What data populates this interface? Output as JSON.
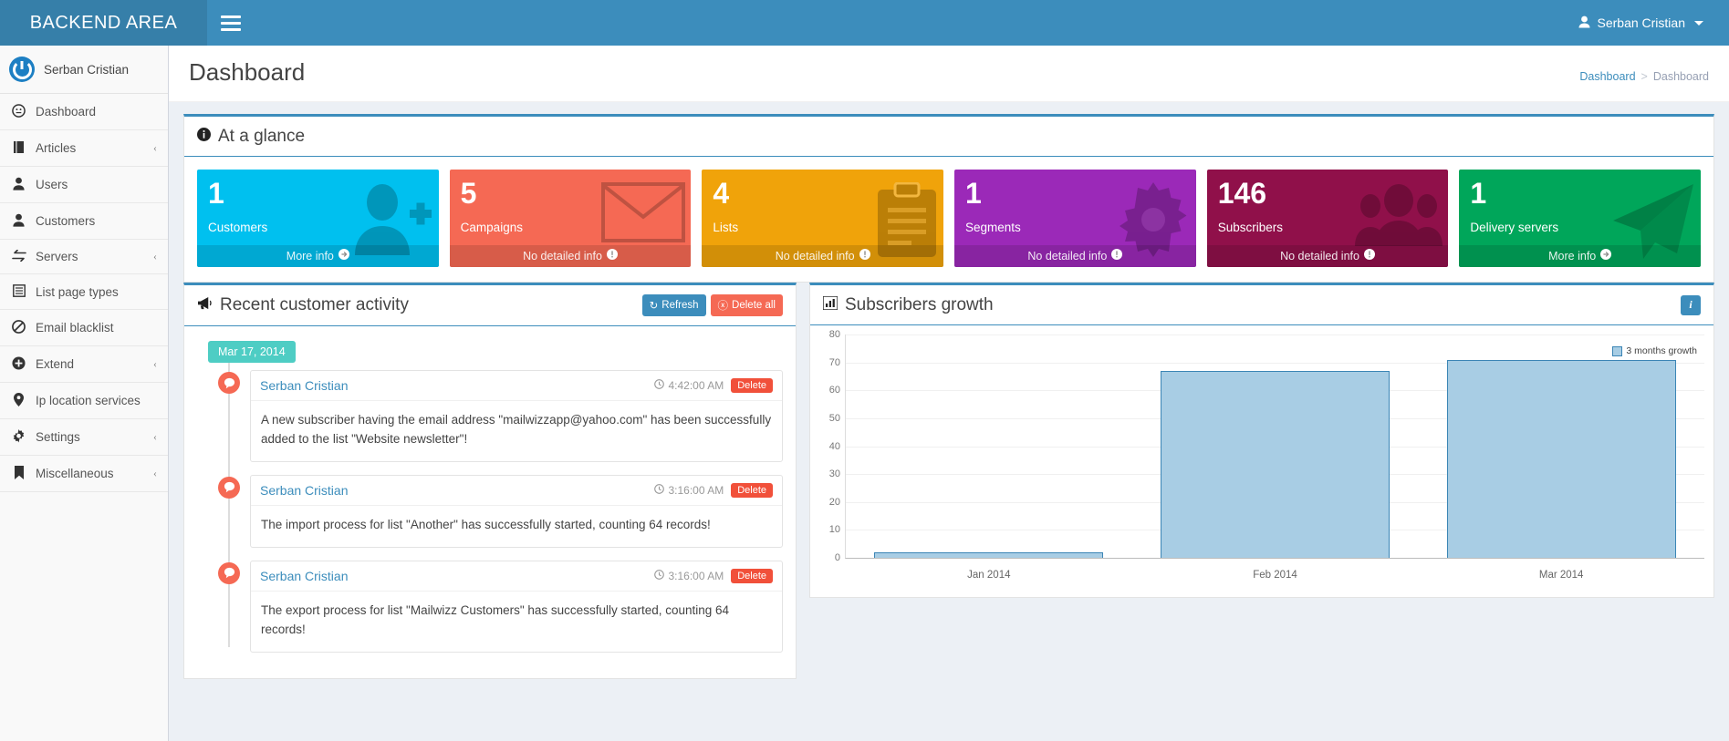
{
  "topbar": {
    "brand": "BACKEND AREA",
    "menu_toggle_icon": "hamburger-icon",
    "user_name": "Serban Cristian",
    "user_icon": "user-icon"
  },
  "sidebar": {
    "user_name": "Serban Cristian",
    "items": [
      {
        "label": "Dashboard",
        "icon": "dashboard-icon",
        "chevron": ""
      },
      {
        "label": "Articles",
        "icon": "book-icon",
        "chevron": "‹"
      },
      {
        "label": "Users",
        "icon": "user-icon",
        "chevron": ""
      },
      {
        "label": "Customers",
        "icon": "user-icon",
        "chevron": ""
      },
      {
        "label": "Servers",
        "icon": "exchange-icon",
        "chevron": "‹"
      },
      {
        "label": "List page types",
        "icon": "list-alt-icon",
        "chevron": ""
      },
      {
        "label": "Email blacklist",
        "icon": "ban-icon",
        "chevron": ""
      },
      {
        "label": "Extend",
        "icon": "plus-circle-icon",
        "chevron": "‹"
      },
      {
        "label": "Ip location services",
        "icon": "map-marker-icon",
        "chevron": ""
      },
      {
        "label": "Settings",
        "icon": "gear-icon",
        "chevron": "‹"
      },
      {
        "label": "Miscellaneous",
        "icon": "bookmark-icon",
        "chevron": "‹"
      }
    ]
  },
  "page": {
    "title": "Dashboard",
    "breadcrumb": {
      "root": "Dashboard",
      "separator": ">",
      "current": "Dashboard"
    }
  },
  "glance": {
    "title": "At a glance",
    "icon": "info-circle-icon",
    "cards": [
      {
        "number": "1",
        "label": "Customers",
        "footer": "More info",
        "footer_icon": "arrow-circle-right-icon",
        "bg_icon": "user-plus-icon",
        "color": "#00c0ef"
      },
      {
        "number": "5",
        "label": "Campaigns",
        "footer": "No detailed info",
        "footer_icon": "exclamation-circle-icon",
        "bg_icon": "envelope-icon",
        "color": "#f56954"
      },
      {
        "number": "4",
        "label": "Lists",
        "footer": "No detailed info",
        "footer_icon": "exclamation-circle-icon",
        "bg_icon": "clipboard-icon",
        "color": "#f0a30a"
      },
      {
        "number": "1",
        "label": "Segments",
        "footer": "No detailed info",
        "footer_icon": "exclamation-circle-icon",
        "bg_icon": "gear-icon",
        "color": "#9b29b8"
      },
      {
        "number": "146",
        "label": "Subscribers",
        "footer": "No detailed info",
        "footer_icon": "exclamation-circle-icon",
        "bg_icon": "group-icon",
        "color": "#90104a"
      },
      {
        "number": "1",
        "label": "Delivery servers",
        "footer": "More info",
        "footer_icon": "arrow-circle-right-icon",
        "bg_icon": "paper-plane-icon",
        "color": "#00a65a"
      }
    ]
  },
  "activity": {
    "title": "Recent customer activity",
    "icon": "bullhorn-icon",
    "refresh_label": "Refresh",
    "refresh_icon": "refresh-icon",
    "delete_all_label": "Delete all",
    "delete_all_icon": "times-circle-icon",
    "date_badge": "Mar 17, 2014",
    "items": [
      {
        "author": "Serban Cristian",
        "time": "4:42:00 AM",
        "time_icon": "clock-icon",
        "delete_label": "Delete",
        "text": "A new subscriber having the email address \"mailwizzapp@yahoo.com\" has been successfully added to the list \"Website newsletter\"!"
      },
      {
        "author": "Serban Cristian",
        "time": "3:16:00 AM",
        "time_icon": "clock-icon",
        "delete_label": "Delete",
        "text": "The import process for list \"Another\" has successfully started, counting 64 records!"
      },
      {
        "author": "Serban Cristian",
        "time": "3:16:00 AM",
        "time_icon": "clock-icon",
        "delete_label": "Delete",
        "text": "The export process for list \"Mailwizz Customers\" has successfully started, counting 64 records!"
      }
    ]
  },
  "growth": {
    "title": "Subscribers growth",
    "icon": "bar-chart-icon",
    "info_icon": "info-icon"
  },
  "chart_data": {
    "type": "bar",
    "title": "Subscribers growth",
    "categories": [
      "Jan 2014",
      "Feb 2014",
      "Mar 2014"
    ],
    "series": [
      {
        "name": "3 months growth",
        "values": [
          2,
          67,
          71
        ],
        "color": "#a8cde4",
        "border_color": "#3b85b5"
      }
    ],
    "xlabel": "",
    "ylabel": "",
    "ylim": [
      0,
      80
    ],
    "yticks": [
      0,
      10,
      20,
      30,
      40,
      50,
      60,
      70,
      80
    ],
    "grid": true,
    "legend": "3 months growth",
    "legend_position": "top-right"
  }
}
